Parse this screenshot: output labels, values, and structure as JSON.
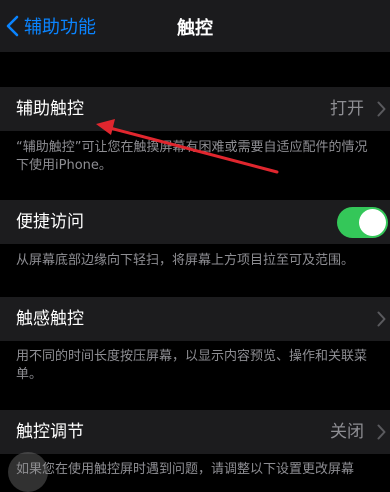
{
  "nav": {
    "back_label": "辅助功能",
    "title": "触控"
  },
  "assistive_touch": {
    "label": "辅助触控",
    "value": "打开",
    "footer": "“辅助触控”可让您在触摸屏幕有困难或需要自适应配件的情况下使用iPhone。"
  },
  "reachability": {
    "label": "便捷访问",
    "enabled": true,
    "footer": "从屏幕底部边缘向下轻扫，将屏幕上方项目拉至可及范围。"
  },
  "haptic_touch": {
    "label": "触感触控",
    "footer": "用不同的时间长度按压屏幕，以显示内容预览、操作和关联菜单。"
  },
  "touch_accommodations": {
    "label": "触控调节",
    "value": "关闭",
    "footer": "如果您在使用触控屏时遇到问题，请调整以下设置更改屏幕"
  },
  "colors": {
    "accent": "#0a84ff",
    "toggle_on": "#34c759",
    "annotation_arrow": "#e0262e"
  }
}
